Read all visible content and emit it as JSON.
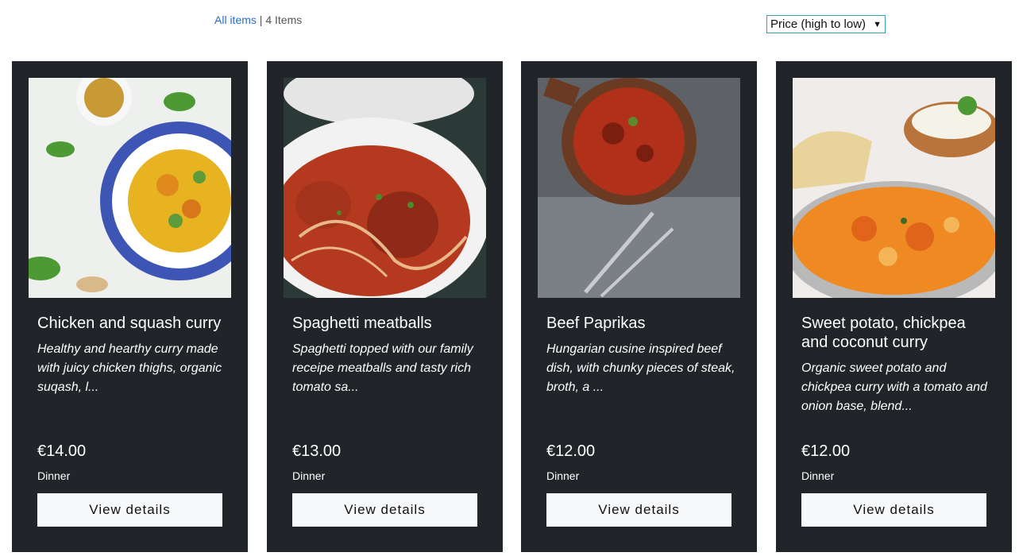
{
  "header": {
    "breadcrumb_link": "All items",
    "separator": "|",
    "count": "4 Items",
    "sort_selected": "Price (high to low)"
  },
  "products": [
    {
      "title": "Chicken and squash curry",
      "description": "Healthy and hearthy curry made with juicy chicken thighs, organic suqash, l...",
      "price": "€14.00",
      "category": "Dinner",
      "button": "View details",
      "image_icon": "curry-bowl-image"
    },
    {
      "title": "Spaghetti meatballs",
      "description": "Spaghetti topped with our family receipe meatballs and tasty rich tomato sa...",
      "price": "€13.00",
      "category": "Dinner",
      "button": "View details",
      "image_icon": "spaghetti-image"
    },
    {
      "title": "Beef Paprikas",
      "description": "Hungarian cusine inspired beef dish, with chunky pieces of steak, broth, a ...",
      "price": "€12.00",
      "category": "Dinner",
      "button": "View details",
      "image_icon": "beef-stew-image"
    },
    {
      "title": "Sweet potato, chickpea and coconut curry",
      "description": "Organic sweet potato and chickpea curry with a tomato and onion base, blend...",
      "price": "€12.00",
      "category": "Dinner",
      "button": "View details",
      "image_icon": "orange-curry-image"
    }
  ],
  "colors": {
    "card_bg": "#212529",
    "button_bg": "#f8f9fa",
    "link": "#2a6ccf"
  }
}
